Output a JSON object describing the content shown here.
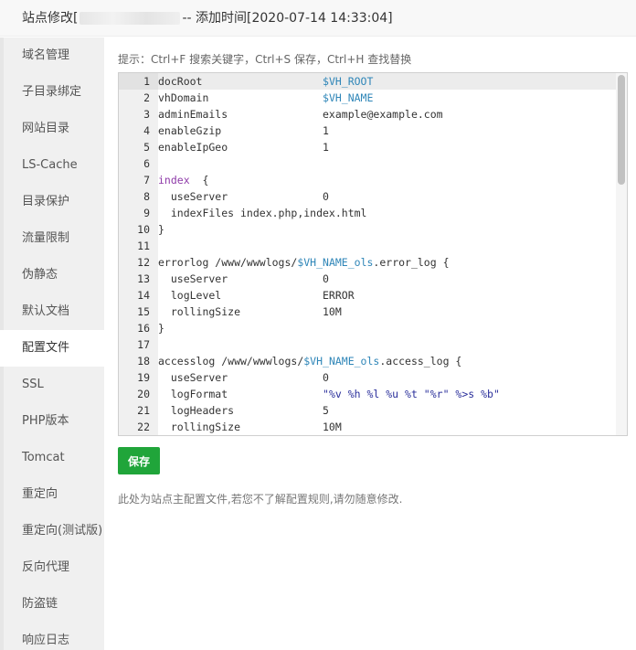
{
  "dialog": {
    "title_prefix": "站点修改[",
    "title_suffix": "-- 添加时间[2020-07-14 14:33:04]"
  },
  "sidebar": {
    "items": [
      {
        "label": "域名管理"
      },
      {
        "label": "子目录绑定"
      },
      {
        "label": "网站目录"
      },
      {
        "label": "LS-Cache"
      },
      {
        "label": "目录保护"
      },
      {
        "label": "流量限制"
      },
      {
        "label": "伪静态"
      },
      {
        "label": "默认文档"
      },
      {
        "label": "配置文件",
        "active": true
      },
      {
        "label": "SSL"
      },
      {
        "label": "PHP版本"
      },
      {
        "label": "Tomcat"
      },
      {
        "label": "重定向"
      },
      {
        "label": "重定向(测试版)"
      },
      {
        "label": "反向代理"
      },
      {
        "label": "防盗链"
      },
      {
        "label": "响应日志"
      }
    ]
  },
  "main": {
    "tip": "提示：Ctrl+F 搜索关键字，Ctrl+S 保存，Ctrl+H 查找替换",
    "save_label": "保存",
    "note": "此处为站点主配置文件,若您不了解配置规则,请勿随意修改."
  },
  "editor": {
    "lines": [
      {
        "n": "1",
        "parts": [
          [
            "docRoot                   ",
            ""
          ],
          [
            "$VH_ROOT",
            "v"
          ]
        ]
      },
      {
        "n": "2",
        "parts": [
          [
            "vhDomain                  ",
            ""
          ],
          [
            "$VH_NAME",
            "v"
          ]
        ]
      },
      {
        "n": "3",
        "parts": [
          [
            "adminEmails               example@example.com",
            ""
          ]
        ]
      },
      {
        "n": "4",
        "parts": [
          [
            "enableGzip                1",
            ""
          ]
        ]
      },
      {
        "n": "5",
        "parts": [
          [
            "enableIpGeo               1",
            ""
          ]
        ]
      },
      {
        "n": "6",
        "parts": [
          [
            "",
            ""
          ]
        ]
      },
      {
        "n": "7",
        "parts": [
          [
            "index",
            "k"
          ],
          [
            "  {",
            ""
          ]
        ]
      },
      {
        "n": "8",
        "parts": [
          [
            "  useServer               0",
            ""
          ]
        ]
      },
      {
        "n": "9",
        "parts": [
          [
            "  indexFiles index.php,index.html",
            ""
          ]
        ]
      },
      {
        "n": "10",
        "parts": [
          [
            "}",
            ""
          ]
        ]
      },
      {
        "n": "11",
        "parts": [
          [
            "",
            ""
          ]
        ]
      },
      {
        "n": "12",
        "parts": [
          [
            "errorlog /www/wwwlogs/",
            ""
          ],
          [
            "$VH_NAME_ols",
            "v"
          ],
          [
            ".error_log {",
            ""
          ]
        ]
      },
      {
        "n": "13",
        "parts": [
          [
            "  useServer               0",
            ""
          ]
        ]
      },
      {
        "n": "14",
        "parts": [
          [
            "  logLevel                ERROR",
            ""
          ]
        ]
      },
      {
        "n": "15",
        "parts": [
          [
            "  rollingSize             10M",
            ""
          ]
        ]
      },
      {
        "n": "16",
        "parts": [
          [
            "}",
            ""
          ]
        ]
      },
      {
        "n": "17",
        "parts": [
          [
            "",
            ""
          ]
        ]
      },
      {
        "n": "18",
        "parts": [
          [
            "accesslog /www/wwwlogs/",
            ""
          ],
          [
            "$VH_NAME_ols",
            "v"
          ],
          [
            ".access_log {",
            ""
          ]
        ]
      },
      {
        "n": "19",
        "parts": [
          [
            "  useServer               0",
            ""
          ]
        ]
      },
      {
        "n": "20",
        "parts": [
          [
            "  logFormat               ",
            ""
          ],
          [
            "\"%v %h %l %u %t \"%r\" %>s %b\"",
            "s"
          ]
        ]
      },
      {
        "n": "21",
        "parts": [
          [
            "  logHeaders              5",
            ""
          ]
        ]
      },
      {
        "n": "22",
        "parts": [
          [
            "  rollingSize             10M",
            ""
          ]
        ]
      }
    ]
  }
}
